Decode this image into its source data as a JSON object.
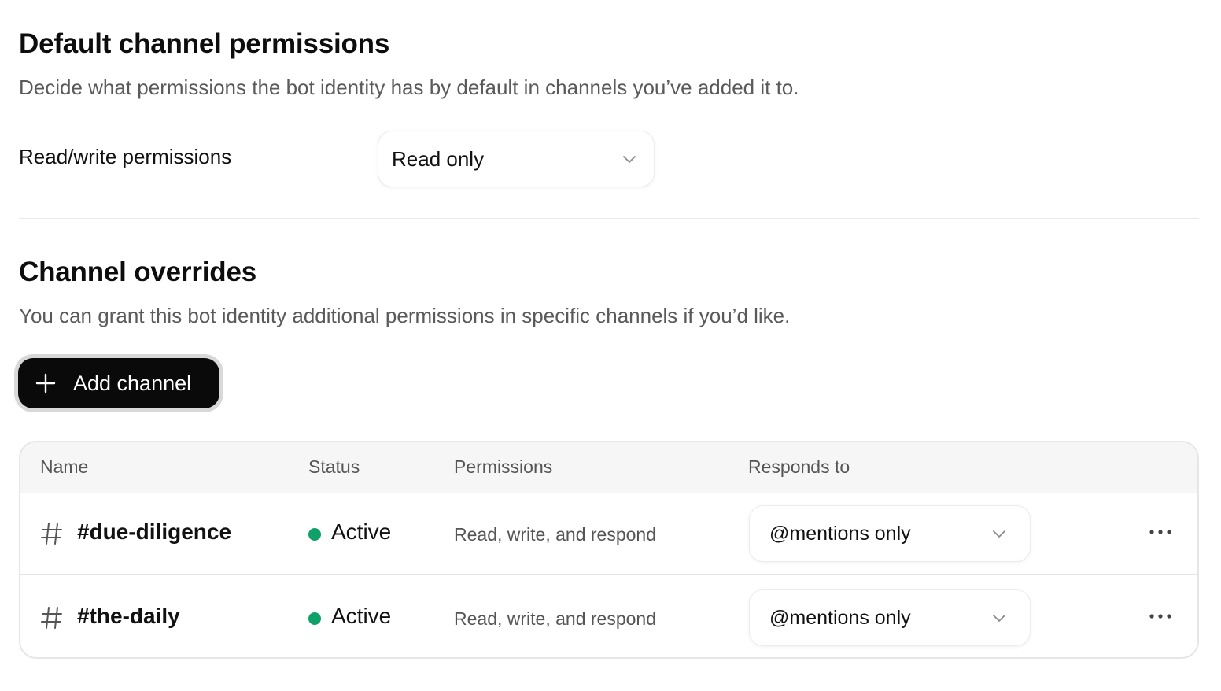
{
  "defaults": {
    "title": "Default channel permissions",
    "description": "Decide what permissions the bot identity has by default in channels you’ve added it to.",
    "rw_label": "Read/write permissions",
    "rw_value": "Read only"
  },
  "overrides": {
    "title": "Channel overrides",
    "description": "You can grant this bot identity additional permissions in specific channels if you’d like.",
    "add_button_label": "Add channel",
    "table": {
      "columns": {
        "name": "Name",
        "status": "Status",
        "permissions": "Permissions",
        "responds_to": "Responds to"
      },
      "rows": [
        {
          "channel": "#due-diligence",
          "status": "Active",
          "permissions": "Read, write, and respond",
          "responds_to": "@mentions only"
        },
        {
          "channel": "#the-daily",
          "status": "Active",
          "permissions": "Read, write, and respond",
          "responds_to": "@mentions only"
        }
      ]
    }
  },
  "icons": {
    "chevron": "chevron-down-icon",
    "hash": "hash-icon",
    "plus": "plus-icon",
    "more": "more-horizontal-icon"
  },
  "colors": {
    "active_status": "#10a06a",
    "primary_button": "#0a0a0a"
  }
}
